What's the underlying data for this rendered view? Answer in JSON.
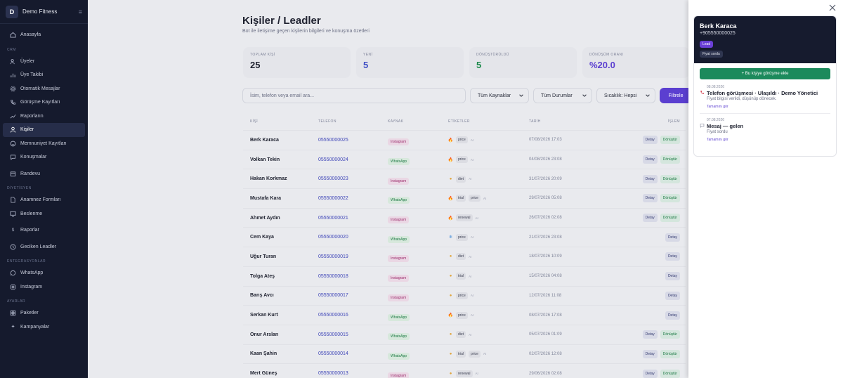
{
  "sidebar": {
    "brand": "Demo Fitness",
    "logo_letter": "D",
    "sections": {
      "crm": "CRM",
      "diyetisyen": "DİYETİSYEN",
      "entegrasyonlar": "ENTEGRASYONLAR",
      "ayarlar": "AYARLAR"
    },
    "items": [
      {
        "label": "Anasayfa",
        "icon": "home-icon"
      },
      {
        "label": "Üyeler",
        "icon": "users-icon"
      },
      {
        "label": "Üye Takibi",
        "icon": "chart-icon"
      },
      {
        "label": "Otomatik Mesajlar",
        "icon": "gear-icon"
      },
      {
        "label": "Görüşme Kayıtları",
        "icon": "phone-icon"
      },
      {
        "label": "Raporların",
        "icon": "trend-icon"
      },
      {
        "label": "Kişiler",
        "icon": "person-icon"
      },
      {
        "label": "Memnuniyet Kayıtları",
        "icon": "smile-icon"
      },
      {
        "label": "Konuşmalar",
        "icon": "chat-icon"
      },
      {
        "label": "Randevu",
        "icon": "calendar-icon"
      },
      {
        "label": "Anamnez Formları",
        "icon": "doc-icon"
      },
      {
        "label": "Beslenme",
        "icon": "monitor-icon"
      },
      {
        "label": "Raporlar",
        "icon": "dollar-icon"
      },
      {
        "label": "Geciken Leadler",
        "icon": "clock-icon"
      },
      {
        "label": "WhatsApp",
        "icon": "whatsapp-icon"
      },
      {
        "label": "Instagram",
        "icon": "instagram-icon"
      },
      {
        "label": "Paketler",
        "icon": "grid-icon"
      },
      {
        "label": "Kampanyalar",
        "icon": "sparkle-icon"
      }
    ]
  },
  "page": {
    "title": "Kişiler / Leadler",
    "subtitle": "Bot ile iletişime geçen kişilerin bilgileri ve konuşma özetleri"
  },
  "stats": [
    {
      "label": "TOPLAM KİŞİ",
      "value": "25",
      "color": "#1f2230"
    },
    {
      "label": "YENİ",
      "value": "5",
      "color": "#3f4fc4"
    },
    {
      "label": "DÖNÜŞTÜRÜLDÜ",
      "value": "5",
      "color": "#1d8a4c"
    },
    {
      "label": "DÖNÜŞÜM ORANI",
      "value": "%20.0",
      "color": "#5b3fd0"
    }
  ],
  "filters": {
    "search_placeholder": "İsim, telefon veya email ara...",
    "sources": "Tüm Kaynaklar",
    "statuses": "Tüm Durumlar",
    "temperature": "Sıcaklık: Hepsi",
    "button": "Filtrele"
  },
  "table": {
    "headers": {
      "name": "KİŞİ",
      "phone": "TELEFON",
      "source": "KAYNAK",
      "tags": "ETİKETLER",
      "date": "TARİH",
      "action": "İŞLEM"
    },
    "action_detail": "Detay",
    "action_converted": "Dönüştür",
    "ai_label": "AI",
    "rows": [
      {
        "name": "Berk Karaca",
        "phone": "05550000025",
        "source": "Instagram",
        "temp": "hot",
        "tags": [
          "price"
        ],
        "date": "07/08/2026 17:03",
        "converted": true
      },
      {
        "name": "Volkan Tekin",
        "phone": "05550000024",
        "source": "WhatsApp",
        "temp": "hot",
        "tags": [
          "price"
        ],
        "date": "04/08/2026 23:08",
        "converted": true
      },
      {
        "name": "Hakan Korkmaz",
        "phone": "05550000023",
        "source": "Instagram",
        "temp": "warm",
        "tags": [
          "diet"
        ],
        "date": "31/07/2026 20:09",
        "converted": true
      },
      {
        "name": "Mustafa Kara",
        "phone": "05550000022",
        "source": "WhatsApp",
        "temp": "hot",
        "tags": [
          "trial",
          "price"
        ],
        "date": "29/07/2026 05:08",
        "converted": true
      },
      {
        "name": "Ahmet Aydın",
        "phone": "05550000021",
        "source": "Instagram",
        "temp": "hot",
        "tags": [
          "renewal"
        ],
        "date": "26/07/2026 02:08",
        "converted": true
      },
      {
        "name": "Cem Kaya",
        "phone": "05550000020",
        "source": "WhatsApp",
        "temp": "cold",
        "tags": [
          "price"
        ],
        "date": "21/07/2026 23:08",
        "converted": false
      },
      {
        "name": "Uğur Turan",
        "phone": "05550000019",
        "source": "Instagram",
        "temp": "warm",
        "tags": [
          "diet"
        ],
        "date": "18/07/2026 10:09",
        "converted": false
      },
      {
        "name": "Tolga Ateş",
        "phone": "05550000018",
        "source": "Instagram",
        "temp": "warm",
        "tags": [
          "trial"
        ],
        "date": "15/07/2026 04:08",
        "converted": false
      },
      {
        "name": "Barış Avcı",
        "phone": "05550000017",
        "source": "Instagram",
        "temp": "warm",
        "tags": [
          "price"
        ],
        "date": "12/07/2026 11:08",
        "converted": false
      },
      {
        "name": "Serkan Kurt",
        "phone": "05550000016",
        "source": "WhatsApp",
        "temp": "hot",
        "tags": [
          "price"
        ],
        "date": "08/07/2026 17:08",
        "converted": false
      },
      {
        "name": "Onur Arslan",
        "phone": "05550000015",
        "source": "WhatsApp",
        "temp": "warm",
        "tags": [
          "diet"
        ],
        "date": "05/07/2026 01:09",
        "converted": true
      },
      {
        "name": "Kaan Şahin",
        "phone": "05550000014",
        "source": "WhatsApp",
        "temp": "warm",
        "tags": [
          "trial",
          "price"
        ],
        "date": "02/07/2026 12:08",
        "converted": true
      },
      {
        "name": "Mert Güneş",
        "phone": "05550000013",
        "source": "Instagram",
        "temp": "warm",
        "tags": [
          "renewal"
        ],
        "date": "29/06/2026 02:08",
        "converted": true
      }
    ]
  },
  "panel": {
    "name": "Berk Karaca",
    "phone": "+905550000025",
    "badge": "Lead",
    "tag": "Fiyat sordu",
    "add_button": "+ Bu kişiye görüşme ekle",
    "timeline": [
      {
        "icon": "phone-icon",
        "date": "08.08.2026",
        "title": "Telefon görüşmesi · Ulaşıldı · Demo Yönetici",
        "desc": "Fiyat bilgisi verildi, düşünüp dönecek.",
        "more": "Tamamını gör"
      },
      {
        "icon": "chat-icon",
        "date": "07.08.2026",
        "title": "Mesaj — gelen",
        "desc": "Fiyat sordu",
        "more": "Tamamını gör"
      }
    ]
  },
  "colors": {
    "sidebar": "#151a2d",
    "accent": "#5b3fd0",
    "green": "#1c8a5c"
  }
}
